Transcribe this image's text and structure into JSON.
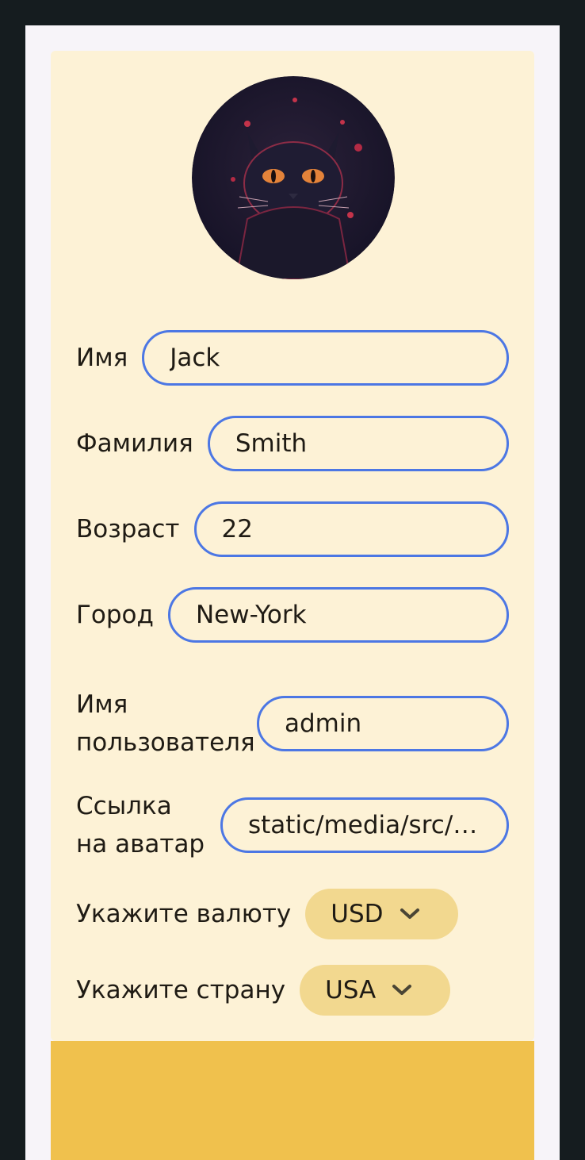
{
  "profile": {
    "avatar_icon": "cat-avatar",
    "fields": [
      {
        "label": "Имя",
        "value": "Jack"
      },
      {
        "label": "Фамилия",
        "value": "Smith"
      },
      {
        "label": "Возраст",
        "value": "22"
      },
      {
        "label": "Город",
        "value": "New-York"
      },
      {
        "label": "Имя пользователя",
        "value": "admin"
      },
      {
        "label": "Ссылка на аватар",
        "value": "static/media/src/sh..."
      }
    ],
    "currency": {
      "label": "Укажите валюту",
      "value": "USD"
    },
    "country": {
      "label": "Укажите страну",
      "value": "USA"
    }
  },
  "colors": {
    "background": "#151c1f",
    "card": "#fdf2d6",
    "accent": "#f0c14d",
    "input_border": "#4c77e4",
    "select_bg": "#f2d88f"
  }
}
